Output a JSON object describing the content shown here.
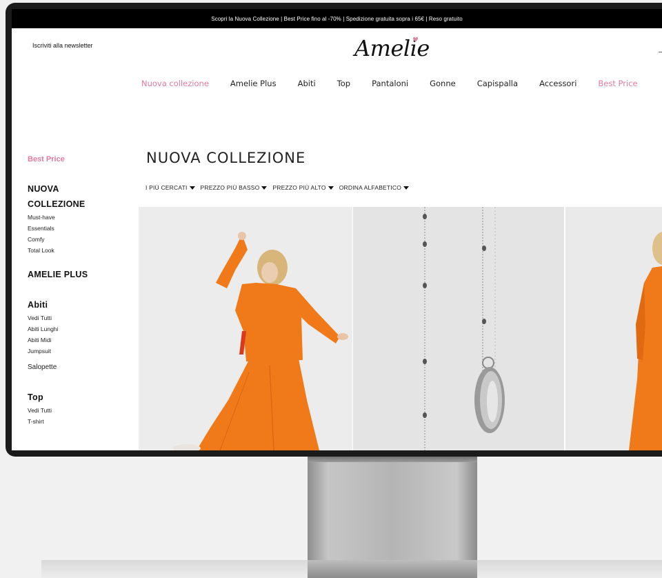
{
  "topbar": {
    "text": "Scopri la Nuova Collezione | Best Price  fino al -70% | Spedizione gratuita sopra i 65€ | Reso gratuito"
  },
  "header": {
    "newsletter": "Iscriviti alla newsletter",
    "logo": "Amelie"
  },
  "nav": [
    {
      "label": "Nuova collezione",
      "highlight": true
    },
    {
      "label": "Amelie Plus",
      "highlight": false
    },
    {
      "label": "Abiti",
      "highlight": false
    },
    {
      "label": "Top",
      "highlight": false
    },
    {
      "label": "Pantaloni",
      "highlight": false
    },
    {
      "label": "Gonne",
      "highlight": false
    },
    {
      "label": "Capispalla",
      "highlight": false
    },
    {
      "label": "Accessori",
      "highlight": false
    },
    {
      "label": "Best Price",
      "highlight": true
    }
  ],
  "sidebar": {
    "best_price": "Best Price",
    "nuova_line1": "NUOVA",
    "nuova_line2": "COLLEZIONE",
    "nuova_items": [
      "Must-have",
      "Essentials",
      "Comfy",
      "Total Look"
    ],
    "amelie_plus": "AMELIE PLUS",
    "abiti": "Abiti",
    "abiti_items": [
      "Vedi Tutti",
      "Abiti Lunghi",
      "Abiti Midi",
      "Jumpsuit"
    ],
    "salopette": "Salopette",
    "top": "Top",
    "top_items": [
      "Vedi Tutti",
      "T-shirt"
    ]
  },
  "main": {
    "title": "NUOVA COLLEZIONE",
    "sorts": [
      "I PIÙ CERCATI",
      "PREZZO PIÙ BASSO",
      "PREZZO PIÙ ALTO",
      "ORDINA ALFABETICO"
    ]
  },
  "colors": {
    "accent_pink": "#e07aa0",
    "product_orange": "#f07a1a"
  }
}
